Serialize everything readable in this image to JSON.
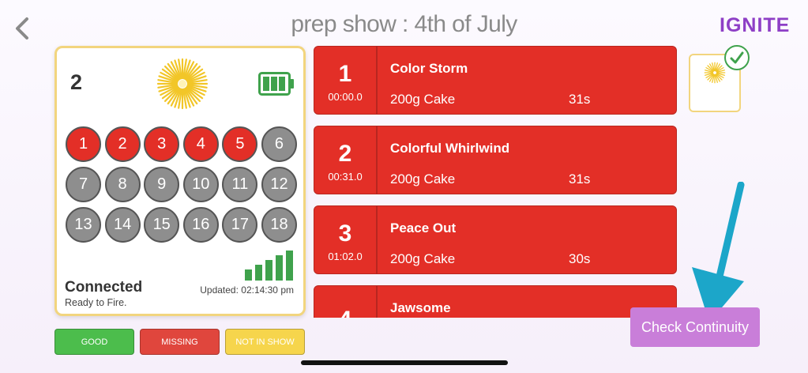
{
  "header": {
    "title": "prep show :  4th of July",
    "brand": "IGNITE"
  },
  "module": {
    "number": "2",
    "status": "Connected",
    "substatus": "Ready to Fire.",
    "updated": "Updated: 02:14:30 pm",
    "battery_level": 1.0,
    "signal_bars": 5,
    "cues": [
      {
        "label": "1",
        "state": "armed"
      },
      {
        "label": "2",
        "state": "armed"
      },
      {
        "label": "3",
        "state": "armed"
      },
      {
        "label": "4",
        "state": "armed"
      },
      {
        "label": "5",
        "state": "armed"
      },
      {
        "label": "6",
        "state": "idle"
      },
      {
        "label": "7",
        "state": "idle"
      },
      {
        "label": "8",
        "state": "idle"
      },
      {
        "label": "9",
        "state": "idle"
      },
      {
        "label": "10",
        "state": "idle"
      },
      {
        "label": "11",
        "state": "idle"
      },
      {
        "label": "12",
        "state": "idle"
      },
      {
        "label": "13",
        "state": "idle"
      },
      {
        "label": "14",
        "state": "idle"
      },
      {
        "label": "15",
        "state": "idle"
      },
      {
        "label": "16",
        "state": "idle"
      },
      {
        "label": "17",
        "state": "idle"
      },
      {
        "label": "18",
        "state": "idle"
      }
    ]
  },
  "legend": {
    "good": "GOOD",
    "missing": "MISSING",
    "not_in_show": "NOT IN SHOW"
  },
  "cue_list": [
    {
      "num": "1",
      "time": "00:00.0",
      "name": "Color Storm",
      "product": "200g Cake",
      "duration": "31s"
    },
    {
      "num": "2",
      "time": "00:31.0",
      "name": "Colorful Whirlwind",
      "product": "200g Cake",
      "duration": "31s"
    },
    {
      "num": "3",
      "time": "01:02.0",
      "name": "Peace Out",
      "product": "200g Cake",
      "duration": "30s"
    },
    {
      "num": "4",
      "time": "",
      "name": "Jawsome",
      "product": "",
      "duration": ""
    }
  ],
  "actions": {
    "check_continuity": "Check Continuity"
  },
  "colors": {
    "armed": "#e32f27",
    "idle": "#8e8e8e",
    "good": "#4cbd4c",
    "missing": "#e0463d",
    "not_in_show": "#f6d54c",
    "accent": "#c97ed9",
    "arrow": "#1ca6c9",
    "brand": "#8e3fc6"
  },
  "icons": {
    "back": "chevron-left-icon",
    "firework": "firework-burst-icon",
    "battery": "battery-full-icon",
    "signal": "signal-bars-icon",
    "check": "checkmark-icon",
    "arrow": "down-pointing-arrow-icon"
  }
}
